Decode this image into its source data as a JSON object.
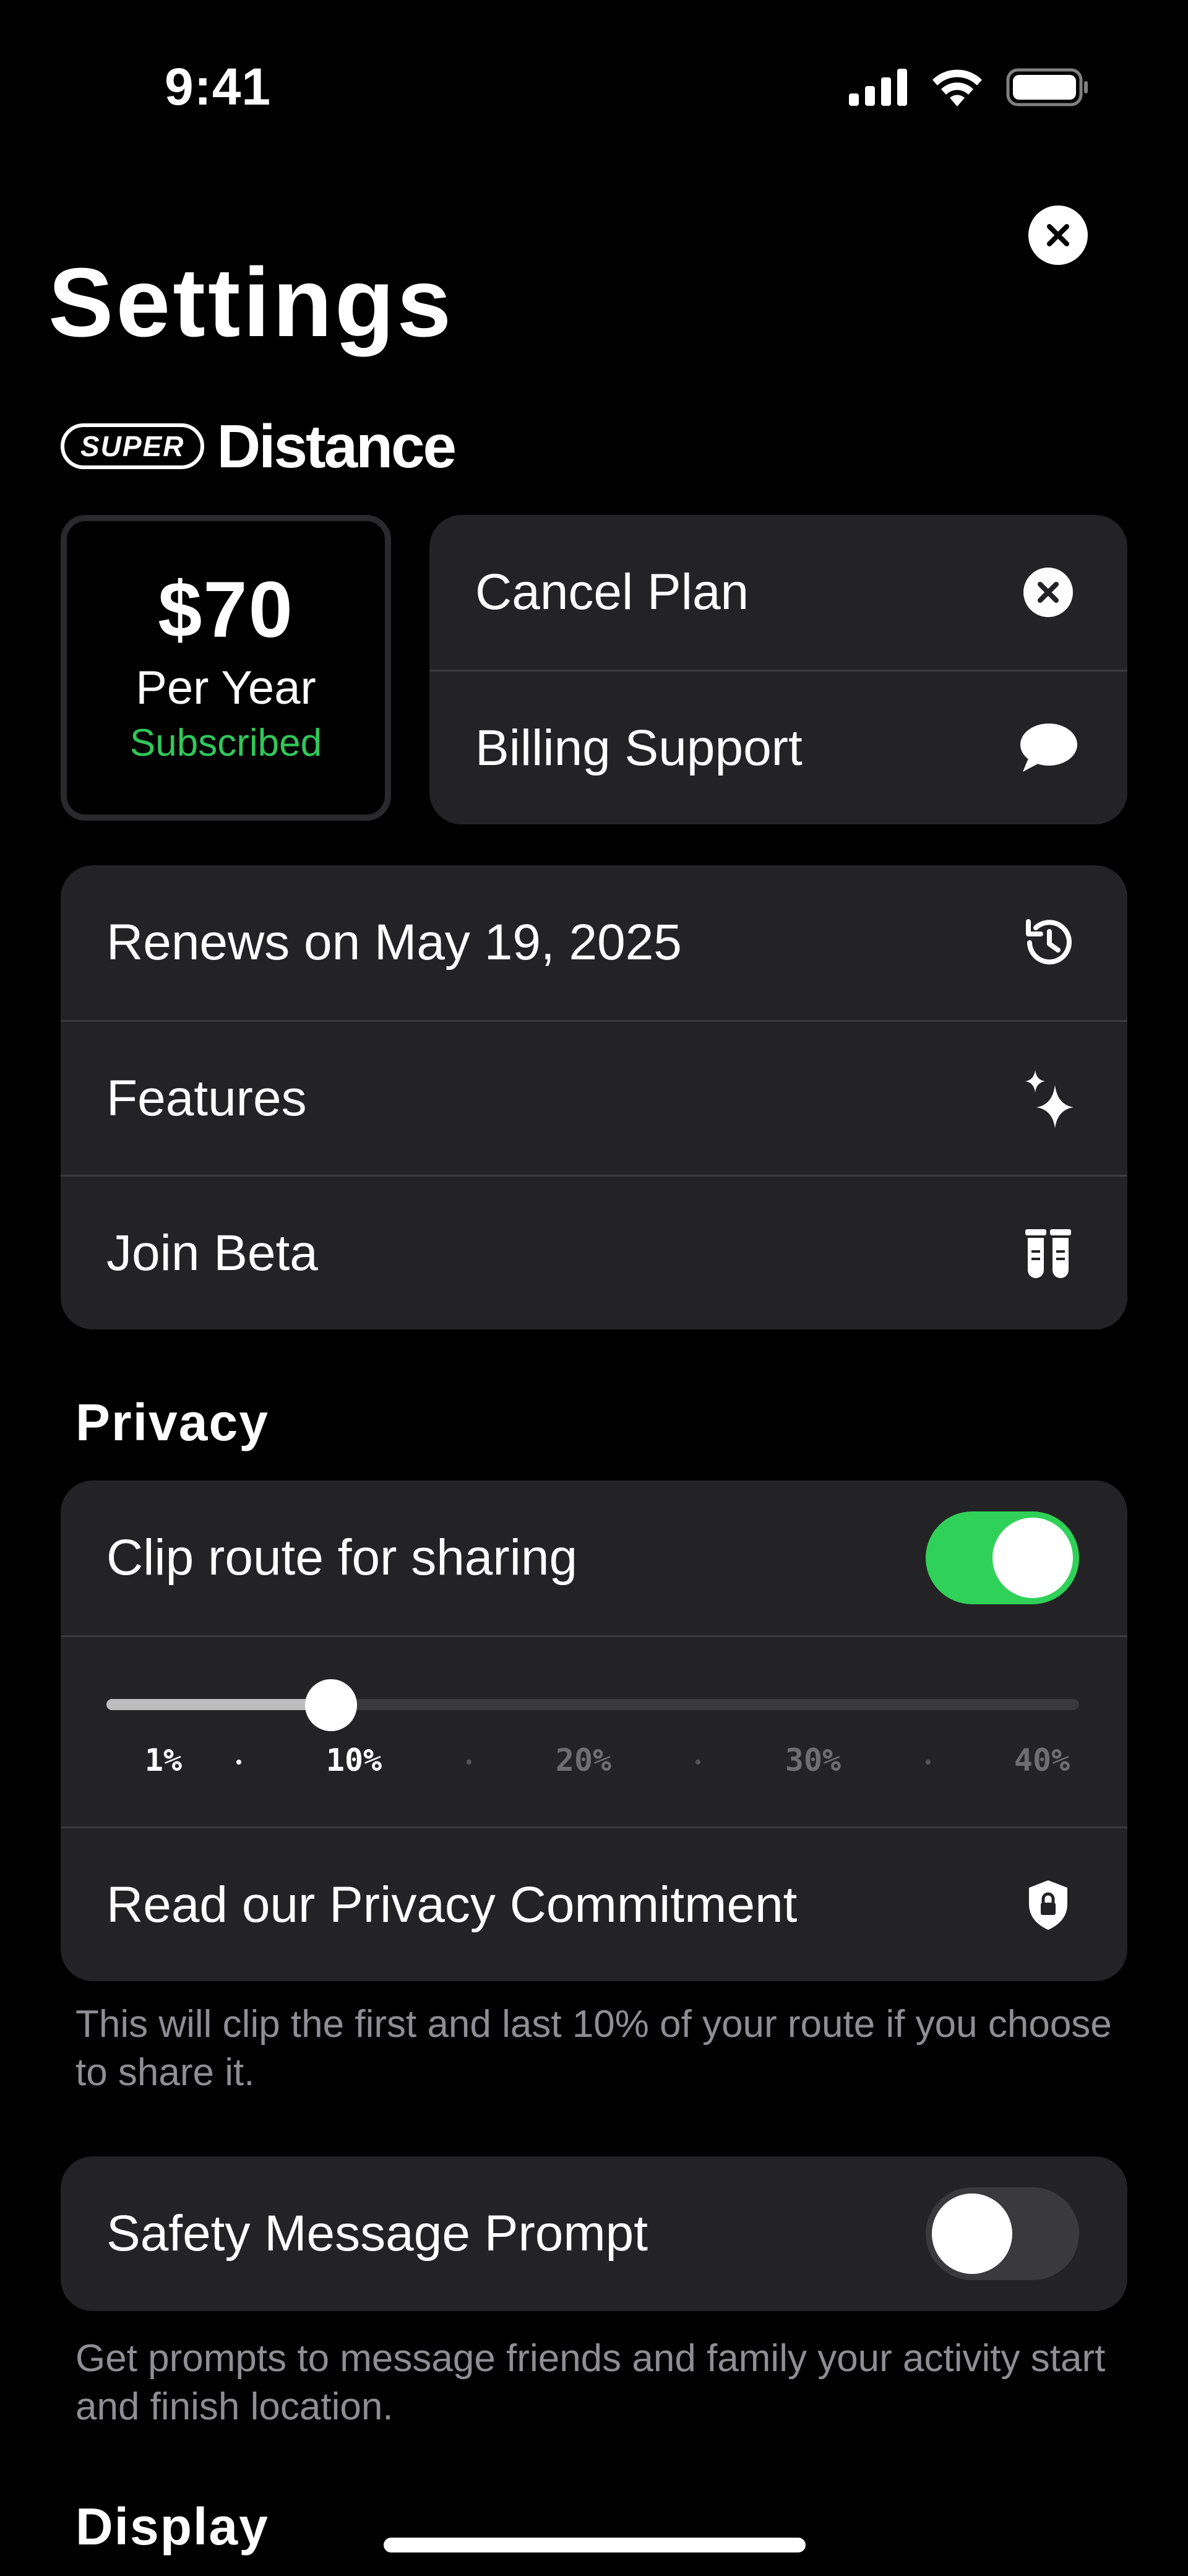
{
  "status_bar": {
    "time": "9:41"
  },
  "title": "Settings",
  "brand": {
    "badge": "SUPER",
    "name": "Distance"
  },
  "plan": {
    "price": "$70",
    "period": "Per Year",
    "status": "Subscribed"
  },
  "actions": [
    {
      "label": "Cancel Plan",
      "icon": "cancel-circle-icon"
    },
    {
      "label": "Billing Support",
      "icon": "chat-bubble-icon"
    }
  ],
  "info_rows": [
    {
      "label": "Renews on May 19, 2025",
      "icon": "history-icon"
    },
    {
      "label": "Features",
      "icon": "sparkles-icon"
    },
    {
      "label": "Join Beta",
      "icon": "test-tubes-icon"
    }
  ],
  "privacy": {
    "section_title": "Privacy",
    "clip_label": "Clip route for sharing",
    "clip_enabled": true,
    "slider": {
      "value_percent": 10,
      "ticks": [
        "1%",
        "10%",
        "20%",
        "30%",
        "40%"
      ],
      "active_tick": "10%"
    },
    "commitment_label": "Read our Privacy Commitment",
    "note": "This will clip the first and last 10% of your route if you choose to share it."
  },
  "safety": {
    "label": "Safety Message Prompt",
    "enabled": false,
    "note": "Get prompts to message friends and family your activity start and finish location."
  },
  "display": {
    "section_title": "Display"
  },
  "colors": {
    "accent_green": "#30d158",
    "card_bg": "#232325",
    "subscribed_text": "#30c85a"
  }
}
